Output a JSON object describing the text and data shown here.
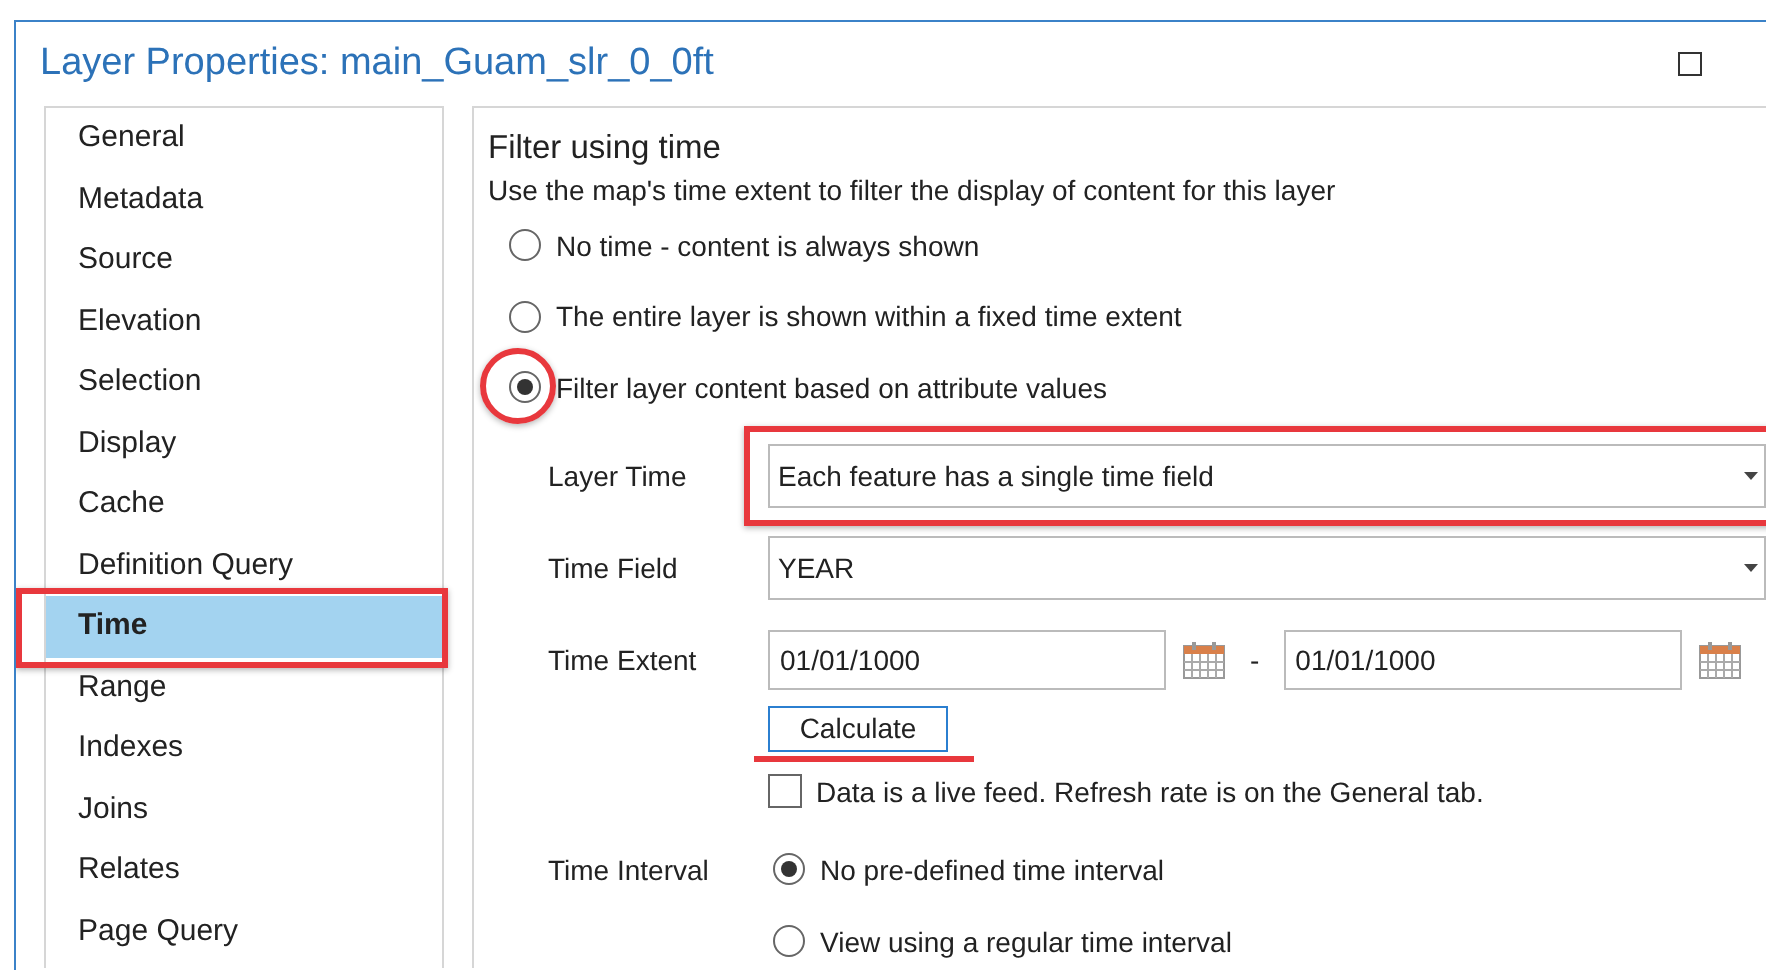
{
  "window": {
    "title": "Layer Properties: main_Guam_slr_0_0ft"
  },
  "sidebar": {
    "items": [
      {
        "label": "General",
        "selected": false,
        "highlighted": false
      },
      {
        "label": "Metadata",
        "selected": false,
        "highlighted": false
      },
      {
        "label": "Source",
        "selected": false,
        "highlighted": false
      },
      {
        "label": "Elevation",
        "selected": false,
        "highlighted": false
      },
      {
        "label": "Selection",
        "selected": false,
        "highlighted": false
      },
      {
        "label": "Display",
        "selected": false,
        "highlighted": false
      },
      {
        "label": "Cache",
        "selected": false,
        "highlighted": false
      },
      {
        "label": "Definition Query",
        "selected": false,
        "highlighted": false
      },
      {
        "label": "Time",
        "selected": true,
        "highlighted": true
      },
      {
        "label": "Range",
        "selected": false,
        "highlighted": false
      },
      {
        "label": "Indexes",
        "selected": false,
        "highlighted": false
      },
      {
        "label": "Joins",
        "selected": false,
        "highlighted": false
      },
      {
        "label": "Relates",
        "selected": false,
        "highlighted": false
      },
      {
        "label": "Page Query",
        "selected": false,
        "highlighted": false
      }
    ]
  },
  "panel": {
    "heading": "Filter using time",
    "description": "Use the map's time extent to filter the display of content for this layer",
    "filter_options": [
      {
        "label": "No time - content is always shown",
        "selected": false,
        "highlighted": false
      },
      {
        "label": "The entire layer is shown within a fixed time extent",
        "selected": false,
        "highlighted": false
      },
      {
        "label": "Filter layer content based on attribute values",
        "selected": true,
        "highlighted": true
      }
    ],
    "layer_time": {
      "label": "Layer Time",
      "value": "Each feature has a single time field",
      "highlighted": true
    },
    "time_field": {
      "label": "Time Field",
      "value": "YEAR"
    },
    "time_extent": {
      "label": "Time Extent",
      "start": "01/01/1000",
      "separator": "-",
      "end": "01/01/1000"
    },
    "calculate_button": {
      "label": "Calculate",
      "underlined": true
    },
    "live_feed": {
      "label": "Data is a live feed. Refresh rate is on the General tab.",
      "checked": false
    },
    "time_interval": {
      "label": "Time Interval",
      "options": [
        {
          "label": "No pre-defined time interval",
          "selected": true
        },
        {
          "label": "View using a regular time interval",
          "selected": false
        }
      ]
    }
  }
}
